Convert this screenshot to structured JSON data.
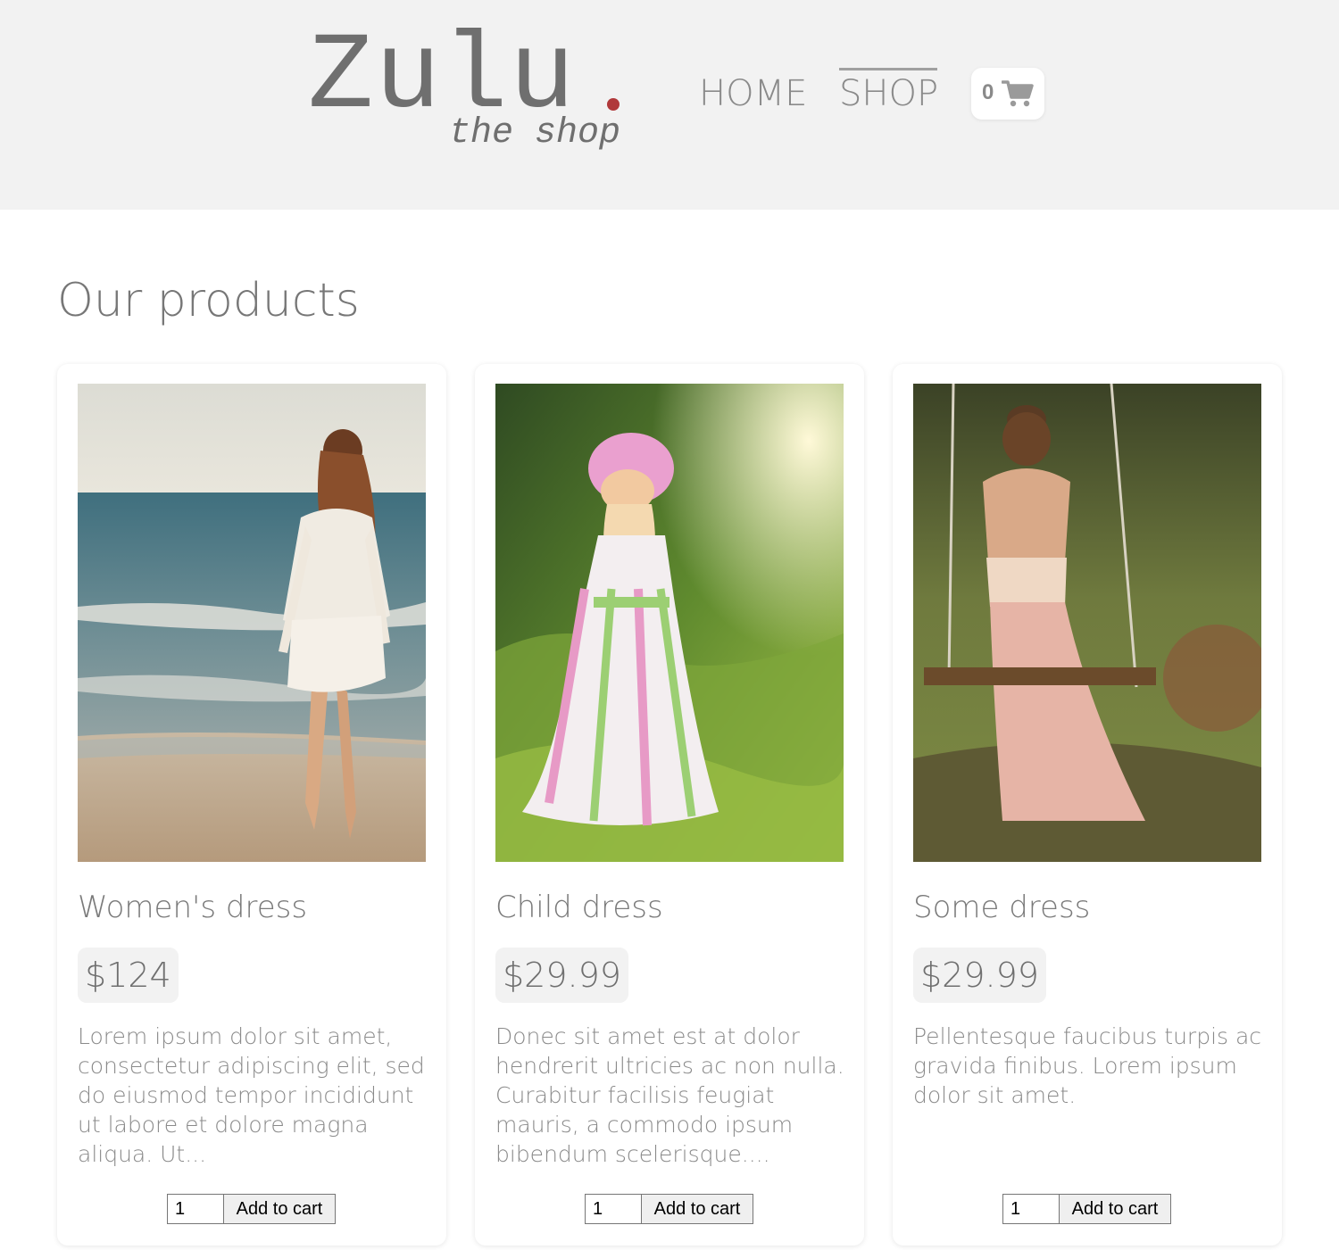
{
  "header": {
    "logo_main": "Zulu",
    "logo_sub": "the shop",
    "nav": {
      "home": "HOME",
      "shop": "SHOP",
      "active": "SHOP"
    },
    "cart": {
      "count": "0",
      "icon": "shopping-cart-icon"
    }
  },
  "main": {
    "title": "Our products",
    "products": [
      {
        "name": "Women's dress",
        "price": "$124",
        "description": "Lorem ipsum dolor sit amet, consectetur adipiscing elit, sed do eiusmod tempor incididunt ut labore et dolore magna aliqua. Ut...",
        "image": "woman-in-white-lace-dress-on-beach",
        "quantity": "1",
        "button_label": "Add to cart"
      },
      {
        "name": "Child dress",
        "price": "$29.99",
        "description": "Donec sit amet est at dolor hendrerit ultricies ac non nulla. Curabitur facilisis feugiat mauris, a commodo ipsum bibendum scelerisque....",
        "image": "girl-in-striped-dress-and-pink-hat-in-meadow",
        "quantity": "1",
        "button_label": "Add to cart"
      },
      {
        "name": "Some dress",
        "price": "$29.99",
        "description": "Pellentesque faucibus turpis ac gravida finibus. Lorem ipsum dolor sit amet.",
        "image": "woman-in-pink-dress-on-tree-swing",
        "quantity": "1",
        "button_label": "Add to cart"
      }
    ]
  },
  "colors": {
    "header_bg": "#f2f2f2",
    "logo_dot": "#b0383a",
    "text": "#777777",
    "price_bg": "#f2f2f2"
  }
}
